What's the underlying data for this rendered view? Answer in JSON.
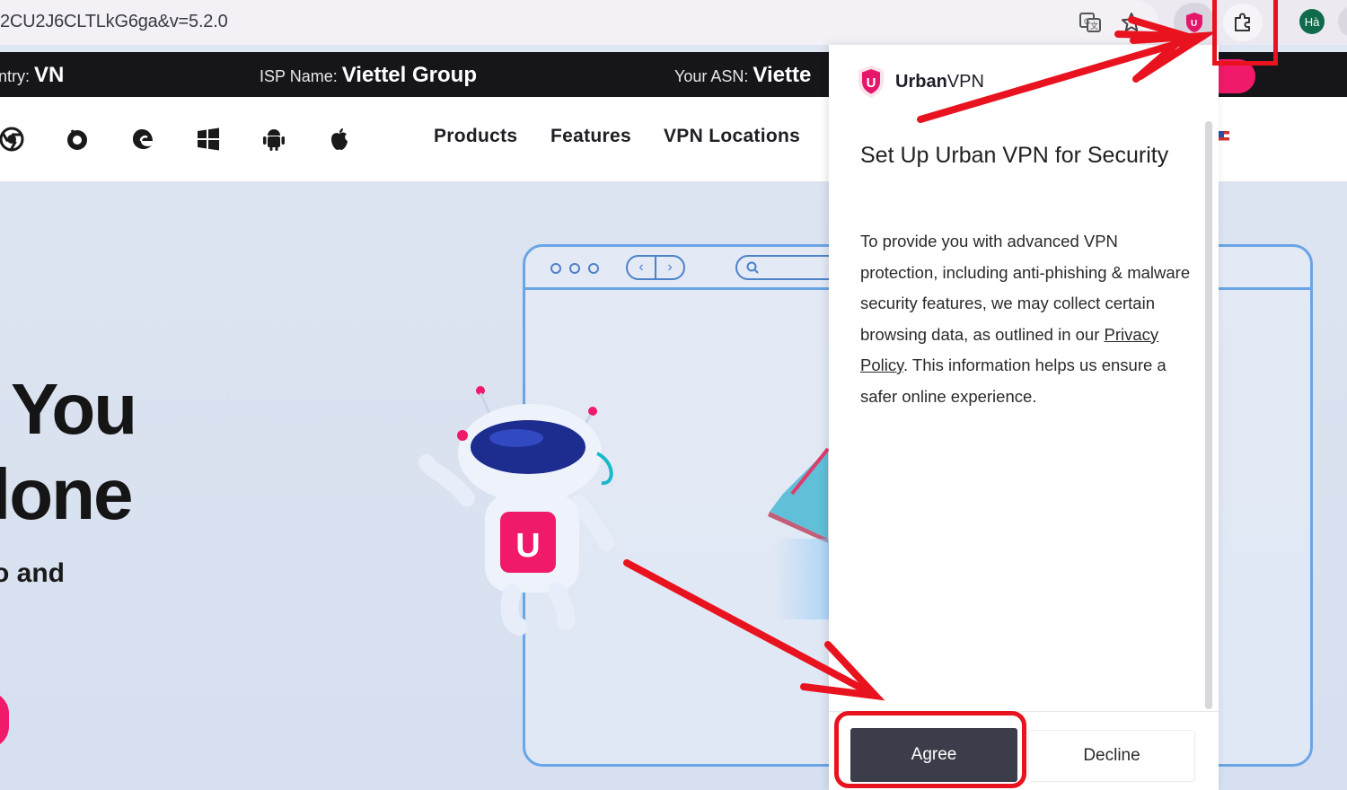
{
  "browser": {
    "url": "2CU2J6CLTLkG6ga&v=5.2.0",
    "avatar_initials": "Hà",
    "icons": [
      "translate-icon",
      "star-icon",
      "urban-vpn-extension-icon",
      "puzzle-extensions-icon"
    ]
  },
  "info_bar": {
    "country_label": "ntry:",
    "country_value": "VN",
    "isp_label": "ISP Name:",
    "isp_value": "Viettel Group",
    "asn_label": "Your ASN:",
    "asn_value": "Viette"
  },
  "nav": {
    "platform_icons": [
      "chrome-icon",
      "firefox-icon",
      "edge-icon",
      "windows-icon",
      "android-icon",
      "apple-icon"
    ],
    "links": [
      "Products",
      "Features",
      "VPN Locations"
    ]
  },
  "hero": {
    "line1": "You",
    "line2": "lone",
    "sub": "o and"
  },
  "popup": {
    "brand_bold": "Urban",
    "brand_light": "VPN",
    "title": "Set Up Urban VPN for Security",
    "body_before": "To provide you with advanced VPN protection, including anti-phishing & malware security features, we may collect certain browsing data, as outlined in our ",
    "body_link": "Privacy Policy",
    "body_after": ". This information helps us ensure a safer online experience.",
    "agree": "Agree",
    "decline": "Decline"
  },
  "colors": {
    "accent": "#f0196a",
    "annotation": "#e8131e",
    "agree_bg": "#3b3d4a",
    "dark_bar": "#16161a"
  }
}
